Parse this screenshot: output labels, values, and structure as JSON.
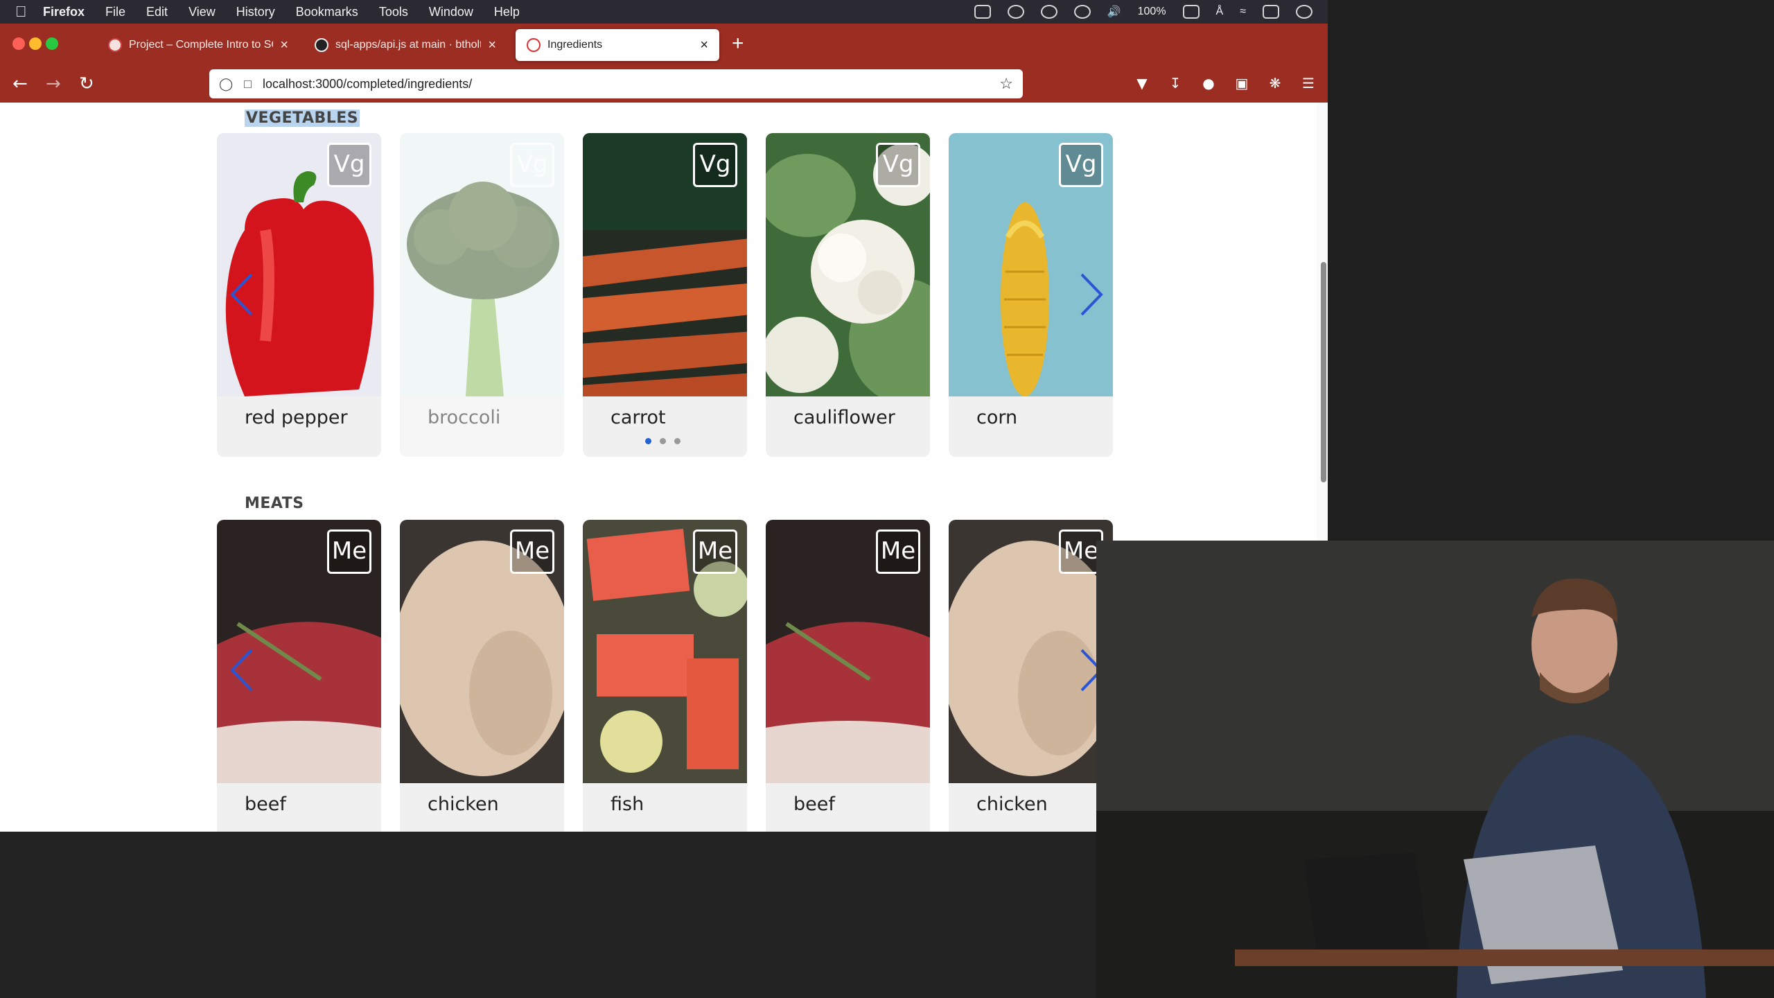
{
  "menubar": {
    "items": [
      "Firefox",
      "File",
      "Edit",
      "View",
      "History",
      "Bookmarks",
      "Tools",
      "Window",
      "Help"
    ],
    "battery": "100%"
  },
  "browser": {
    "tabs": [
      {
        "label": "Project – Complete Intro to SQL"
      },
      {
        "label": "sql-apps/api.js at main · btholt/s"
      },
      {
        "label": "Ingredients"
      }
    ],
    "url": "localhost:3000/completed/ingredients/"
  },
  "colors": {
    "chrome": "#9c2d22",
    "arrow": "#2a55d4",
    "selection": "#b9d4ee"
  },
  "sections": [
    {
      "title": "VEGETABLES",
      "items": [
        {
          "name": "red pepper",
          "badge": "Vg"
        },
        {
          "name": "broccoli",
          "badge": "Vg"
        },
        {
          "name": "carrot",
          "badge": "Vg"
        },
        {
          "name": "cauliflower",
          "badge": "Vg"
        },
        {
          "name": "corn",
          "badge": "Vg"
        }
      ]
    },
    {
      "title": "MEATS",
      "items": [
        {
          "name": "beef",
          "badge": "Me"
        },
        {
          "name": "chicken",
          "badge": "Me"
        },
        {
          "name": "fish",
          "badge": "Me"
        },
        {
          "name": "beef",
          "badge": "Me"
        },
        {
          "name": "chicken",
          "badge": "Me"
        }
      ]
    }
  ]
}
